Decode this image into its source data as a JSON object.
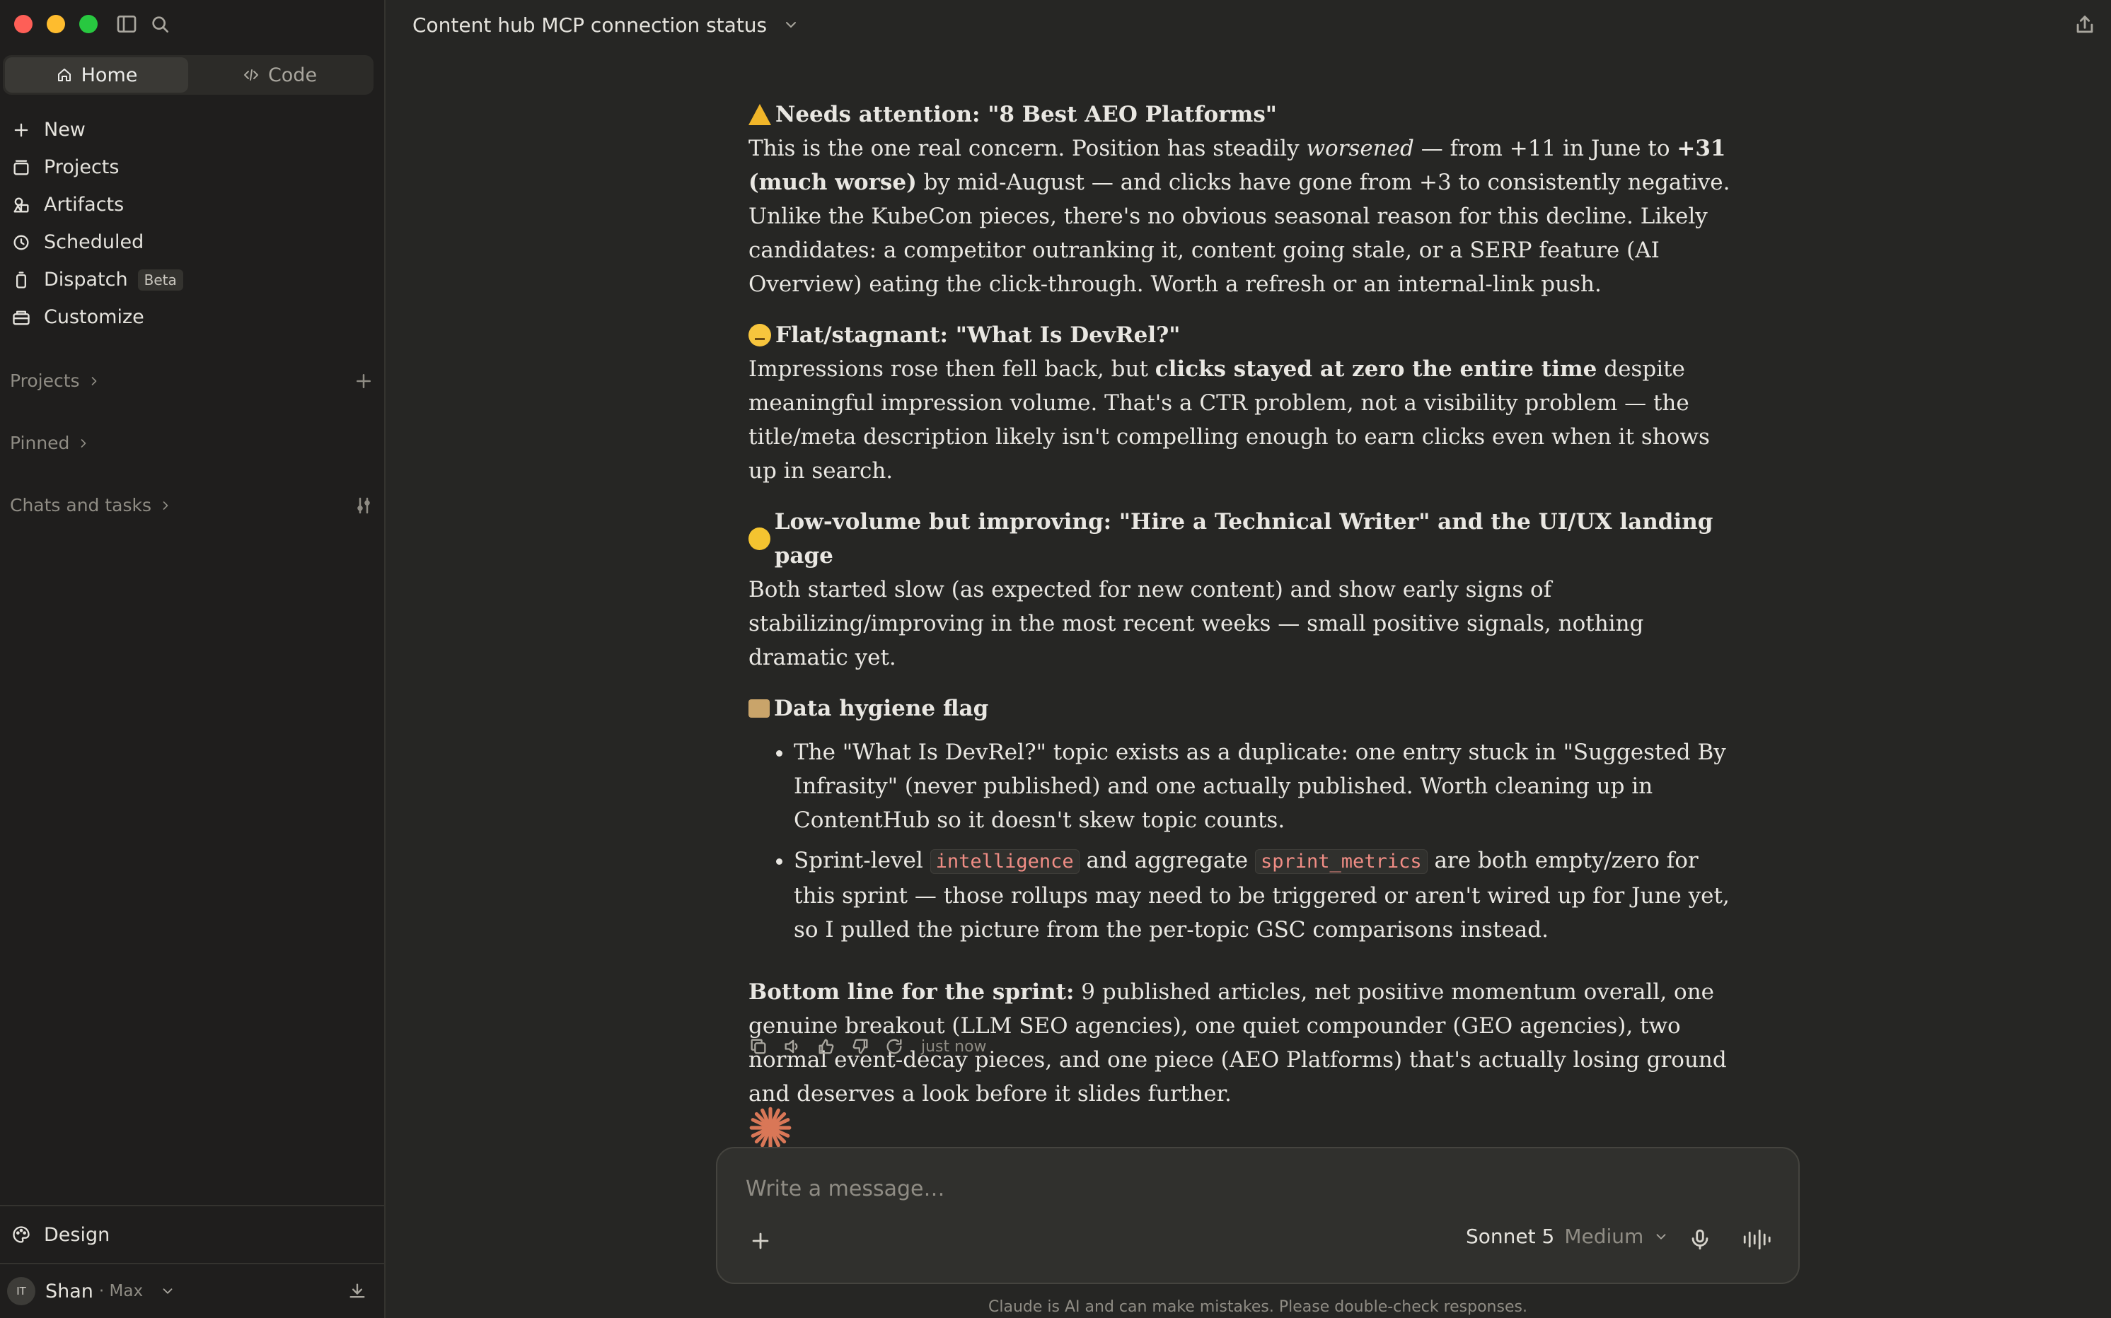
{
  "sidebar": {
    "mode": {
      "home_label": "Home",
      "code_label": "Code"
    },
    "nav": [
      {
        "label": "New",
        "icon": "plus-icon"
      },
      {
        "label": "Projects",
        "icon": "projects-icon"
      },
      {
        "label": "Artifacts",
        "icon": "artifacts-icon"
      },
      {
        "label": "Scheduled",
        "icon": "clock-icon"
      },
      {
        "label": "Dispatch",
        "icon": "dispatch-icon",
        "badge": "Beta"
      },
      {
        "label": "Customize",
        "icon": "customize-icon"
      }
    ],
    "sections": {
      "projects": "Projects",
      "pinned": "Pinned",
      "chats": "Chats and tasks"
    },
    "design_label": "Design",
    "user": {
      "initials": "IT",
      "name": "Shan",
      "plan": "· Max"
    }
  },
  "header": {
    "title": "Content hub MCP connection status"
  },
  "message": {
    "s1_title": "Needs attention: \"8 Best AEO Platforms\"",
    "s1_a": "This is the one real concern. Position has steadily ",
    "s1_em": "worsened",
    "s1_b": " — from +11 in June to ",
    "s1_strong": "+31 (much worse)",
    "s1_c": " by mid-August — and clicks have gone from +3 to consistently negative. Unlike the KubeCon pieces, there's no obvious seasonal reason for this decline. Likely candidates: a competitor outranking it, content going stale, or a SERP feature (AI Overview) eating the click-through. Worth a refresh or an internal-link push.",
    "s2_title": "Flat/stagnant: \"What Is DevRel?\"",
    "s2_a": "Impressions rose then fell back, but ",
    "s2_strong": "clicks stayed at zero the entire time",
    "s2_b": " despite meaningful impression volume. That's a CTR problem, not a visibility problem — the title/meta description likely isn't compelling enough to earn clicks even when it shows up in search.",
    "s3_title": "Low-volume but improving: \"Hire a Technical Writer\" and the UI/UX landing page",
    "s3_text": "Both started slow (as expected for new content) and show early signs of stabilizing/improving in the most recent weeks — small positive signals, nothing dramatic yet.",
    "s4_title": "Data hygiene flag",
    "b1": "The \"What Is DevRel?\" topic exists as a duplicate: one entry stuck in \"Suggested By Infrasity\" (never published) and one actually published. Worth cleaning up in ContentHub so it doesn't skew topic counts.",
    "b2_a": "Sprint-level ",
    "b2_code1": "intelligence",
    "b2_b": " and aggregate ",
    "b2_code2": "sprint_metrics",
    "b2_c": " are both empty/zero for this sprint — those rollups may need to be triggered or aren't wired up for June yet, so I pulled the picture from the per-topic GSC comparisons instead.",
    "bl_strong": "Bottom line for the sprint:",
    "bl_text": " 9 published articles, net positive momentum overall, one genuine breakout (LLM SEO agencies), one quiet compounder (GEO agencies), two normal event-decay pieces, and one piece (AEO Platforms) that's actually losing ground and deserves a look before it slides further."
  },
  "actions": {
    "timestamp": "just now"
  },
  "composer": {
    "placeholder": "Write a message…",
    "model": "Sonnet 5",
    "effort": "Medium",
    "disclaimer": "Claude is AI and can make mistakes. Please double-check responses."
  },
  "colors": {
    "accent": "#d97757",
    "background": "#262624",
    "sidebar": "#1f1e1d"
  }
}
